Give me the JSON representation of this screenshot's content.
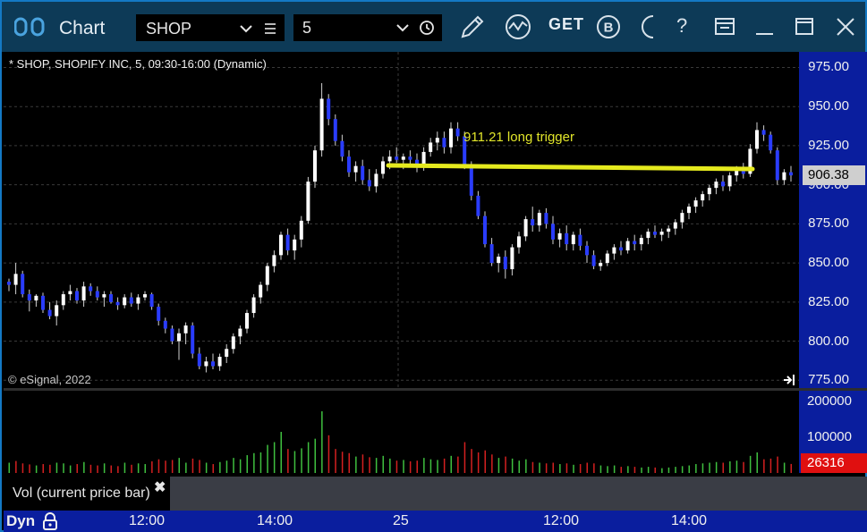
{
  "titlebar": {
    "title": "Chart",
    "symbol": "SHOP",
    "interval": "5",
    "get_label": "GET",
    "icons": [
      "app-icon",
      "chevron-down-icon",
      "menu-icon",
      "clock-icon",
      "pencil-icon",
      "study-icon",
      "get-icon",
      "b-circle-icon",
      "moon-icon",
      "help-icon",
      "window-icon",
      "minimize-icon",
      "maximize-icon",
      "close-icon"
    ],
    "help_glyph": "?"
  },
  "chart": {
    "info": "* SHOP, SHOPIFY INC, 5, 09:30-16:00 (Dynamic)",
    "copyright": "© eSignal, 2022",
    "annotation": "911.21 long trigger",
    "last_price": "906.38",
    "price_ticks": [
      "975.00",
      "950.00",
      "925.00",
      "900.00",
      "875.00",
      "850.00",
      "825.00",
      "800.00",
      "775.00"
    ]
  },
  "volume": {
    "legend": "Vol (current price bar)",
    "close_glyph": "✖",
    "ticks": [
      "200000",
      "100000"
    ],
    "last_volume": "26316"
  },
  "time_axis": {
    "mode": "Dyn",
    "labels": [
      "12:00",
      "14:00",
      "25",
      "12:00",
      "14:00"
    ]
  },
  "colors": {
    "titlebar": "#0d3a57",
    "axis": "#0a1e9e",
    "up": "#ffffff",
    "down": "#2a3cff",
    "trigger_line": "#e5ea1e",
    "vol_up": "#3fbf3f",
    "vol_down": "#d42020"
  },
  "chart_data": {
    "type": "candlestick",
    "symbol": "SHOP",
    "ylim": [
      770,
      985
    ],
    "trigger_level": 911.21,
    "candles": [
      [
        838,
        840,
        832,
        836
      ],
      [
        836,
        850,
        830,
        843
      ],
      [
        843,
        845,
        828,
        830
      ],
      [
        830,
        833,
        819,
        826
      ],
      [
        826,
        830,
        822,
        829
      ],
      [
        829,
        831,
        818,
        820
      ],
      [
        820,
        825,
        814,
        816
      ],
      [
        816,
        826,
        810,
        823
      ],
      [
        823,
        832,
        820,
        830
      ],
      [
        830,
        836,
        826,
        832
      ],
      [
        832,
        834,
        824,
        826
      ],
      [
        826,
        838,
        822,
        835
      ],
      [
        835,
        837,
        829,
        832
      ],
      [
        832,
        835,
        826,
        828
      ],
      [
        828,
        832,
        822,
        830
      ],
      [
        830,
        832,
        824,
        825
      ],
      [
        825,
        828,
        820,
        823
      ],
      [
        823,
        830,
        821,
        828
      ],
      [
        828,
        831,
        822,
        824
      ],
      [
        824,
        830,
        820,
        828
      ],
      [
        828,
        832,
        826,
        830
      ],
      [
        830,
        831,
        820,
        822
      ],
      [
        822,
        824,
        810,
        813
      ],
      [
        813,
        815,
        805,
        808
      ],
      [
        808,
        810,
        798,
        800
      ],
      [
        800,
        808,
        788,
        805
      ],
      [
        805,
        812,
        798,
        810
      ],
      [
        810,
        812,
        789,
        792
      ],
      [
        792,
        796,
        782,
        784
      ],
      [
        784,
        790,
        780,
        787
      ],
      [
        787,
        792,
        782,
        784
      ],
      [
        784,
        792,
        781,
        790
      ],
      [
        790,
        798,
        786,
        795
      ],
      [
        795,
        805,
        792,
        803
      ],
      [
        803,
        810,
        798,
        808
      ],
      [
        808,
        820,
        805,
        818
      ],
      [
        818,
        830,
        815,
        828
      ],
      [
        828,
        838,
        824,
        836
      ],
      [
        836,
        850,
        832,
        848
      ],
      [
        848,
        858,
        844,
        855
      ],
      [
        855,
        870,
        852,
        868
      ],
      [
        868,
        872,
        855,
        858
      ],
      [
        858,
        868,
        852,
        865
      ],
      [
        865,
        880,
        860,
        877
      ],
      [
        877,
        905,
        875,
        902
      ],
      [
        902,
        925,
        898,
        922
      ],
      [
        922,
        965,
        918,
        955
      ],
      [
        955,
        958,
        938,
        942
      ],
      [
        942,
        945,
        925,
        928
      ],
      [
        928,
        932,
        915,
        918
      ],
      [
        918,
        922,
        905,
        908
      ],
      [
        908,
        915,
        902,
        912
      ],
      [
        912,
        916,
        900,
        903
      ],
      [
        903,
        910,
        896,
        899
      ],
      [
        899,
        910,
        895,
        907
      ],
      [
        907,
        918,
        904,
        915
      ],
      [
        915,
        922,
        910,
        918
      ],
      [
        918,
        924,
        914,
        916
      ],
      [
        916,
        920,
        910,
        918
      ],
      [
        918,
        922,
        913,
        916
      ],
      [
        916,
        920,
        908,
        911
      ],
      [
        911,
        924,
        909,
        921
      ],
      [
        921,
        930,
        918,
        927
      ],
      [
        927,
        934,
        922,
        930
      ],
      [
        930,
        934,
        920,
        924
      ],
      [
        924,
        940,
        920,
        936
      ],
      [
        936,
        940,
        928,
        931
      ],
      [
        931,
        934,
        910,
        913
      ],
      [
        913,
        915,
        890,
        893
      ],
      [
        893,
        896,
        878,
        880
      ],
      [
        880,
        883,
        860,
        862
      ],
      [
        862,
        866,
        848,
        850
      ],
      [
        850,
        856,
        844,
        854
      ],
      [
        854,
        858,
        840,
        846
      ],
      [
        846,
        862,
        842,
        860
      ],
      [
        860,
        870,
        856,
        867
      ],
      [
        867,
        880,
        864,
        878
      ],
      [
        878,
        886,
        870,
        874
      ],
      [
        874,
        884,
        870,
        882
      ],
      [
        882,
        885,
        872,
        875
      ],
      [
        875,
        880,
        862,
        865
      ],
      [
        865,
        872,
        860,
        869
      ],
      [
        869,
        874,
        858,
        862
      ],
      [
        862,
        870,
        858,
        868
      ],
      [
        868,
        872,
        858,
        861
      ],
      [
        861,
        864,
        850,
        855
      ],
      [
        855,
        858,
        846,
        848
      ],
      [
        848,
        852,
        845,
        850
      ],
      [
        850,
        858,
        848,
        856
      ],
      [
        856,
        862,
        852,
        860
      ],
      [
        860,
        864,
        855,
        858
      ],
      [
        858,
        866,
        856,
        864
      ],
      [
        864,
        868,
        858,
        862
      ],
      [
        862,
        868,
        858,
        866
      ],
      [
        866,
        872,
        862,
        870
      ],
      [
        870,
        874,
        866,
        868
      ],
      [
        868,
        872,
        864,
        870
      ],
      [
        870,
        874,
        866,
        872
      ],
      [
        872,
        878,
        868,
        876
      ],
      [
        876,
        884,
        872,
        882
      ],
      [
        882,
        888,
        878,
        886
      ],
      [
        886,
        892,
        882,
        890
      ],
      [
        890,
        896,
        886,
        894
      ],
      [
        894,
        900,
        890,
        898
      ],
      [
        898,
        904,
        894,
        902
      ],
      [
        902,
        906,
        896,
        899
      ],
      [
        899,
        908,
        896,
        906
      ],
      [
        906,
        912,
        902,
        910
      ],
      [
        910,
        914,
        904,
        907
      ],
      [
        907,
        926,
        905,
        923
      ],
      [
        923,
        940,
        920,
        935
      ],
      [
        935,
        938,
        928,
        932
      ],
      [
        932,
        934,
        920,
        922
      ],
      [
        922,
        924,
        900,
        903
      ],
      [
        903,
        910,
        900,
        908
      ],
      [
        908,
        912,
        902,
        906
      ]
    ],
    "volume_ylim": [
      0,
      240000
    ],
    "volumes": [
      [
        30000,
        1
      ],
      [
        35000,
        0
      ],
      [
        28000,
        0
      ],
      [
        25000,
        0
      ],
      [
        22000,
        1
      ],
      [
        26000,
        0
      ],
      [
        24000,
        0
      ],
      [
        30000,
        1
      ],
      [
        28000,
        1
      ],
      [
        22000,
        1
      ],
      [
        26000,
        0
      ],
      [
        32000,
        1
      ],
      [
        24000,
        0
      ],
      [
        22000,
        0
      ],
      [
        28000,
        1
      ],
      [
        22000,
        0
      ],
      [
        20000,
        0
      ],
      [
        30000,
        1
      ],
      [
        24000,
        0
      ],
      [
        28000,
        1
      ],
      [
        26000,
        1
      ],
      [
        34000,
        0
      ],
      [
        40000,
        0
      ],
      [
        36000,
        0
      ],
      [
        38000,
        0
      ],
      [
        44000,
        1
      ],
      [
        30000,
        1
      ],
      [
        42000,
        0
      ],
      [
        38000,
        0
      ],
      [
        30000,
        1
      ],
      [
        26000,
        0
      ],
      [
        32000,
        1
      ],
      [
        36000,
        1
      ],
      [
        44000,
        1
      ],
      [
        40000,
        1
      ],
      [
        52000,
        1
      ],
      [
        58000,
        1
      ],
      [
        60000,
        1
      ],
      [
        82000,
        1
      ],
      [
        90000,
        1
      ],
      [
        120000,
        1
      ],
      [
        70000,
        0
      ],
      [
        64000,
        1
      ],
      [
        72000,
        1
      ],
      [
        90000,
        1
      ],
      [
        100000,
        1
      ],
      [
        180000,
        1
      ],
      [
        110000,
        0
      ],
      [
        70000,
        0
      ],
      [
        62000,
        0
      ],
      [
        58000,
        0
      ],
      [
        48000,
        1
      ],
      [
        54000,
        0
      ],
      [
        46000,
        0
      ],
      [
        44000,
        1
      ],
      [
        50000,
        1
      ],
      [
        42000,
        1
      ],
      [
        36000,
        0
      ],
      [
        38000,
        1
      ],
      [
        34000,
        0
      ],
      [
        36000,
        0
      ],
      [
        44000,
        1
      ],
      [
        40000,
        1
      ],
      [
        38000,
        1
      ],
      [
        42000,
        0
      ],
      [
        50000,
        1
      ],
      [
        48000,
        0
      ],
      [
        90000,
        0
      ],
      [
        70000,
        0
      ],
      [
        60000,
        0
      ],
      [
        66000,
        0
      ],
      [
        54000,
        0
      ],
      [
        44000,
        1
      ],
      [
        48000,
        0
      ],
      [
        42000,
        1
      ],
      [
        36000,
        1
      ],
      [
        40000,
        1
      ],
      [
        32000,
        0
      ],
      [
        30000,
        1
      ],
      [
        28000,
        0
      ],
      [
        30000,
        0
      ],
      [
        26000,
        1
      ],
      [
        28000,
        0
      ],
      [
        24000,
        1
      ],
      [
        26000,
        0
      ],
      [
        30000,
        0
      ],
      [
        28000,
        0
      ],
      [
        22000,
        1
      ],
      [
        20000,
        1
      ],
      [
        22000,
        1
      ],
      [
        18000,
        0
      ],
      [
        20000,
        1
      ],
      [
        18000,
        0
      ],
      [
        16000,
        1
      ],
      [
        18000,
        1
      ],
      [
        16000,
        0
      ],
      [
        14000,
        1
      ],
      [
        16000,
        1
      ],
      [
        18000,
        1
      ],
      [
        20000,
        1
      ],
      [
        22000,
        1
      ],
      [
        26000,
        1
      ],
      [
        28000,
        1
      ],
      [
        30000,
        1
      ],
      [
        32000,
        1
      ],
      [
        30000,
        0
      ],
      [
        34000,
        1
      ],
      [
        36000,
        1
      ],
      [
        32000,
        0
      ],
      [
        50000,
        1
      ],
      [
        60000,
        1
      ],
      [
        40000,
        0
      ],
      [
        42000,
        0
      ],
      [
        48000,
        0
      ],
      [
        30000,
        1
      ],
      [
        26316,
        0
      ]
    ]
  }
}
